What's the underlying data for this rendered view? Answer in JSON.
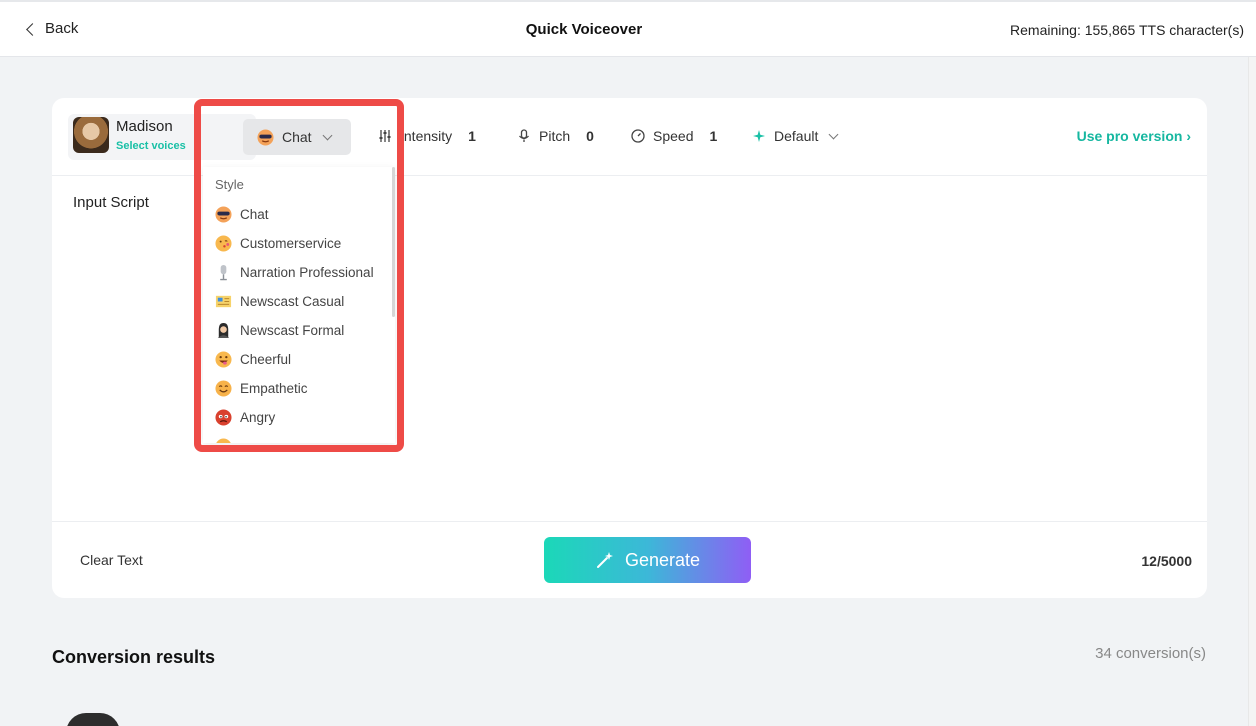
{
  "header": {
    "back_label": "Back",
    "title": "Quick Voiceover",
    "remaining": "Remaining: 155,865 TTS character(s)"
  },
  "voice": {
    "name": "Madison",
    "select_label": "Select voices"
  },
  "toolbar": {
    "style_label": "Chat",
    "intensity_label": "Intensity",
    "intensity_value": "1",
    "pitch_label": "Pitch",
    "pitch_value": "0",
    "speed_label": "Speed",
    "speed_value": "1",
    "mode_label": "Default",
    "pro_label": "Use pro version"
  },
  "editor": {
    "input_label": "Input Script",
    "clear_label": "Clear Text",
    "generate_label": "Generate",
    "counter": "12/5000"
  },
  "style_dropdown": {
    "heading": "Style",
    "items": [
      {
        "label": "Chat",
        "icon": "sunglasses-face-icon"
      },
      {
        "label": "Customerservice",
        "icon": "kissing-face-icon"
      },
      {
        "label": "Narration Professional",
        "icon": "microphone-icon"
      },
      {
        "label": "Newscast Casual",
        "icon": "newspaper-icon"
      },
      {
        "label": "Newscast Formal",
        "icon": "woman-icon"
      },
      {
        "label": "Cheerful",
        "icon": "tongue-face-icon"
      },
      {
        "label": "Empathetic",
        "icon": "smiling-face-icon"
      },
      {
        "label": "Angry",
        "icon": "angry-face-icon"
      }
    ]
  },
  "results": {
    "title": "Conversion results",
    "count": "34 conversion(s)"
  },
  "colors": {
    "accent": "#19c0a6",
    "highlight": "#ee4b47",
    "generate_start": "#1bd8b8",
    "generate_end": "#8f5ef5"
  }
}
